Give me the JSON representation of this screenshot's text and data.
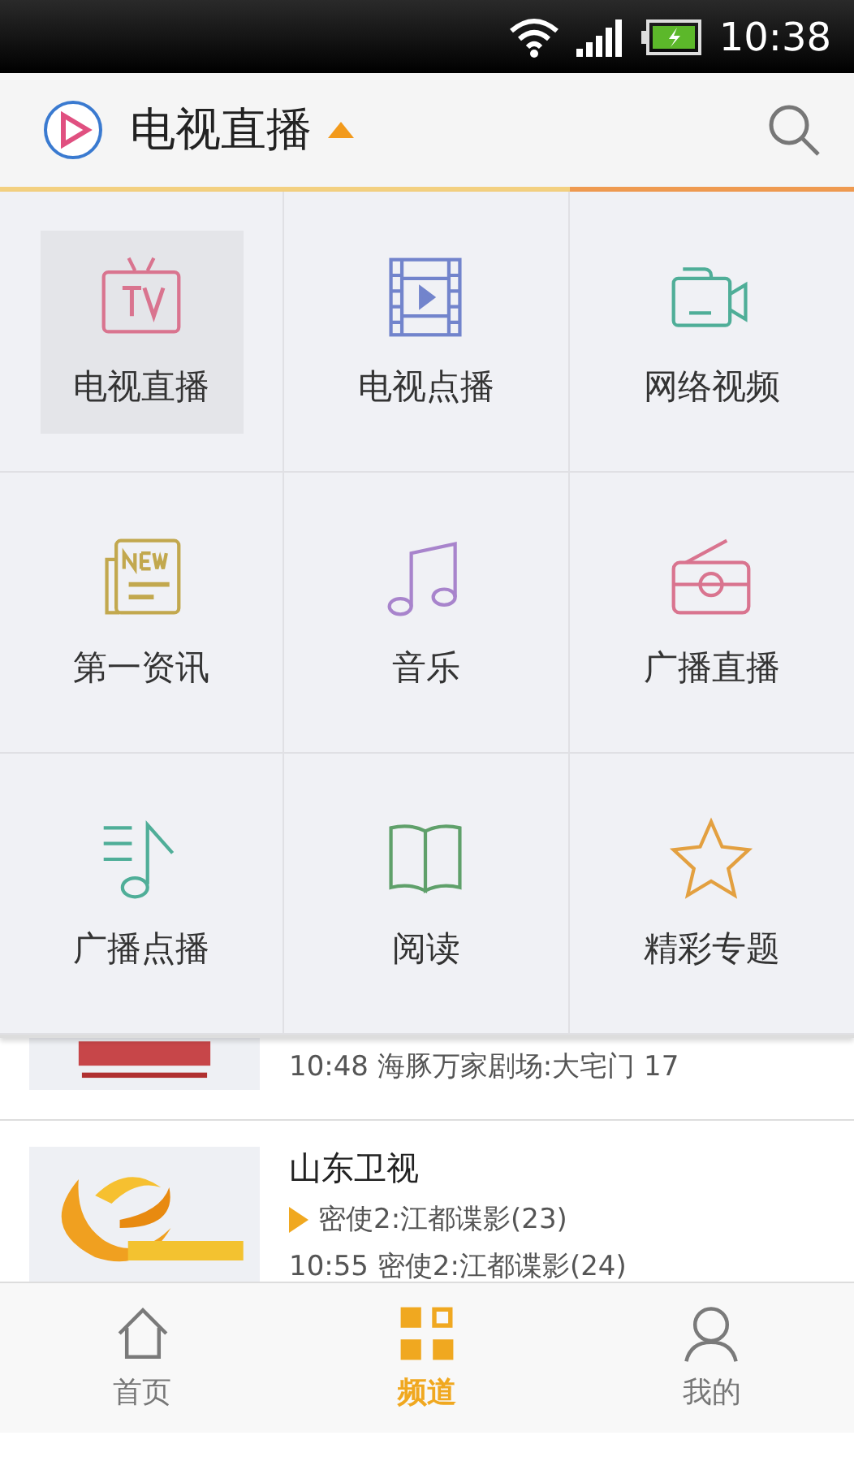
{
  "status_bar": {
    "time": "10:38"
  },
  "header": {
    "title": "电视直播"
  },
  "menu": [
    {
      "label": "电视直播",
      "kind": "tv",
      "color": "#d9748f",
      "selected": true
    },
    {
      "label": "电视点播",
      "kind": "film",
      "color": "#7284cc",
      "selected": false
    },
    {
      "label": "网络视频",
      "kind": "camera",
      "color": "#4fae98",
      "selected": false
    },
    {
      "label": "第一资讯",
      "kind": "news",
      "color": "#c2a84e",
      "selected": false
    },
    {
      "label": "音乐",
      "kind": "music",
      "color": "#a884cc",
      "selected": false
    },
    {
      "label": "广播直播",
      "kind": "radio",
      "color": "#d9748f",
      "selected": false
    },
    {
      "label": "广播点播",
      "kind": "playlist",
      "color": "#4fae98",
      "selected": false
    },
    {
      "label": "阅读",
      "kind": "book",
      "color": "#5fa06a",
      "selected": false
    },
    {
      "label": "精彩专题",
      "kind": "star",
      "color": "#e3a040",
      "selected": false
    }
  ],
  "channels": [
    {
      "kind": "picture",
      "lines": [
        "10:48 海豚万家剧场:大宅门 17"
      ]
    },
    {
      "kind": "picture",
      "name": "山东卫视",
      "now": "密使2:江都谍影(23)",
      "lines": [
        "10:55 密使2:江都谍影(24)"
      ]
    }
  ],
  "nav": [
    {
      "label": "首页",
      "kind": "home",
      "selected": false
    },
    {
      "label": "频道",
      "kind": "grid",
      "selected": true
    },
    {
      "label": "我的",
      "kind": "person",
      "selected": false
    }
  ]
}
